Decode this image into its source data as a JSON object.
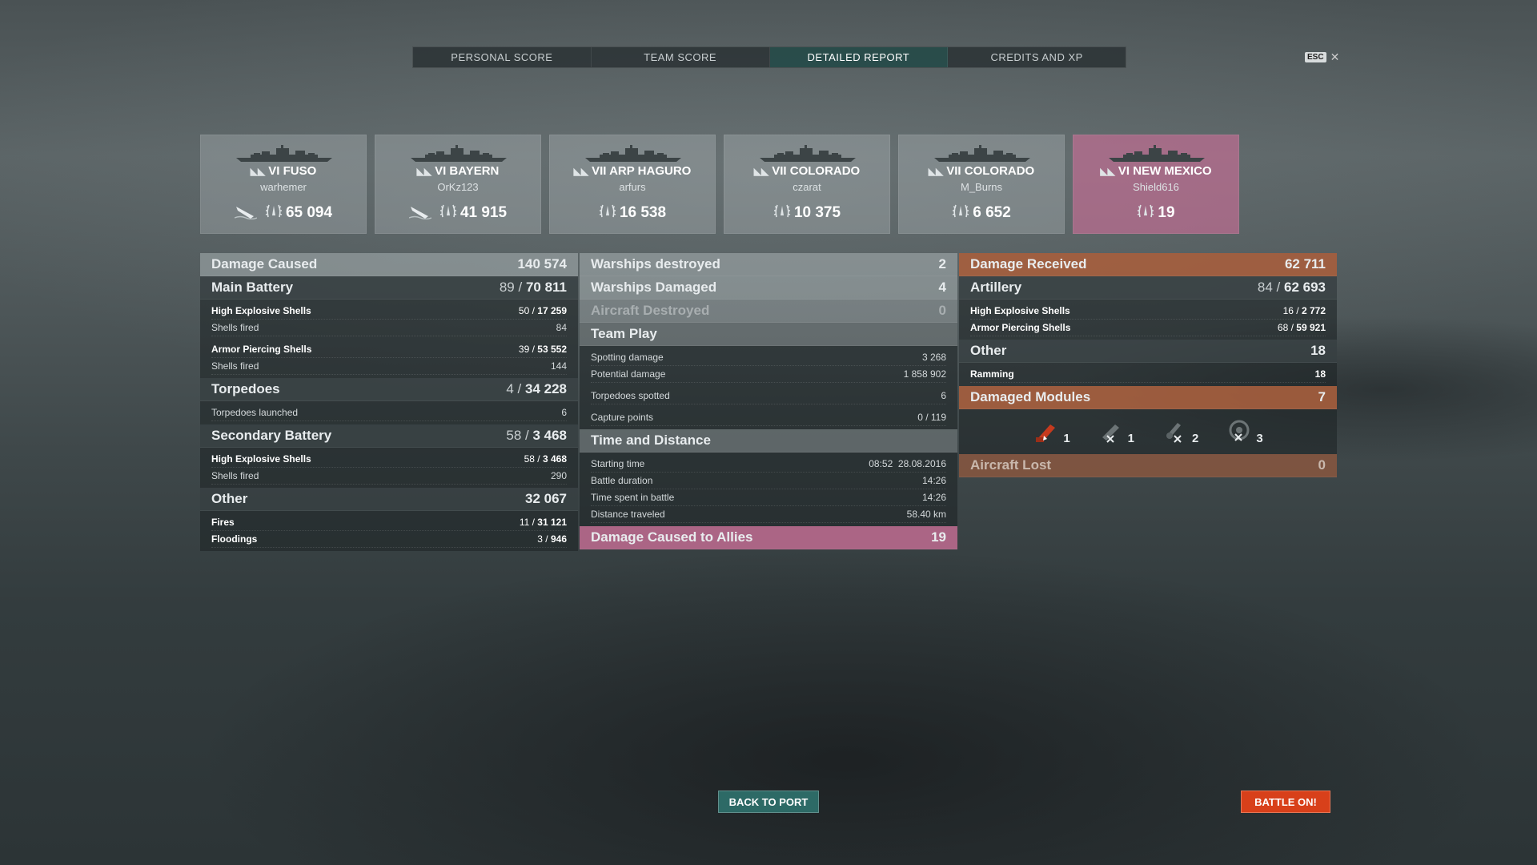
{
  "tabs": [
    "PERSONAL SCORE",
    "TEAM SCORE",
    "DETAILED REPORT",
    "CREDITS AND XP"
  ],
  "active_tab": "DETAILED REPORT",
  "esc_label": "ESC",
  "ships": [
    {
      "tier": "VI",
      "name": "FUSO",
      "player": "warhemer",
      "damage": "65 094",
      "sunk": true
    },
    {
      "tier": "VI",
      "name": "BAYERN",
      "player": "OrKz123",
      "damage": "41 915",
      "sunk": true
    },
    {
      "tier": "VII",
      "name": "ARP HAGURO",
      "player": "arfurs",
      "damage": "16 538",
      "sunk": false
    },
    {
      "tier": "VII",
      "name": "COLORADO",
      "player": "czarat",
      "damage": "10 375",
      "sunk": false
    },
    {
      "tier": "VII",
      "name": "COLORADO",
      "player": "M_Burns",
      "damage": "6 652",
      "sunk": false
    },
    {
      "tier": "VI",
      "name": "NEW MEXICO",
      "player": "Shield616",
      "damage": "19",
      "sunk": false
    }
  ],
  "left": {
    "damage_caused": {
      "label": "Damage Caused",
      "value": "140 574"
    },
    "main_battery": {
      "label": "Main Battery",
      "hits": "89",
      "dmg": "70 811"
    },
    "he": {
      "label": "High Explosive Shells",
      "hits": "50",
      "dmg": "17 259"
    },
    "he_fired": {
      "label": "Shells fired",
      "value": "84"
    },
    "ap": {
      "label": "Armor Piercing Shells",
      "hits": "39",
      "dmg": "53 552"
    },
    "ap_fired": {
      "label": "Shells fired",
      "value": "144"
    },
    "torpedoes": {
      "label": "Torpedoes",
      "hits": "4",
      "dmg": "34 228"
    },
    "torp_launched": {
      "label": "Torpedoes launched",
      "value": "6"
    },
    "secondary": {
      "label": "Secondary Battery",
      "hits": "58",
      "dmg": "3 468"
    },
    "sec_he": {
      "label": "High Explosive Shells",
      "hits": "58",
      "dmg": "3 468"
    },
    "sec_fired": {
      "label": "Shells fired",
      "value": "290"
    },
    "other": {
      "label": "Other",
      "value": "32 067"
    },
    "fires": {
      "label": "Fires",
      "hits": "11",
      "dmg": "31 121"
    },
    "floodings": {
      "label": "Floodings",
      "hits": "3",
      "dmg": "946"
    }
  },
  "mid": {
    "destroyed": {
      "label": "Warships destroyed",
      "value": "2"
    },
    "damaged": {
      "label": "Warships Damaged",
      "value": "4"
    },
    "aircraft": {
      "label": "Aircraft Destroyed",
      "value": "0"
    },
    "teamplay": {
      "label": "Team Play"
    },
    "spotting": {
      "label": "Spotting damage",
      "value": "3 268"
    },
    "potential": {
      "label": "Potential damage",
      "value": "1 858 902"
    },
    "torp_spotted": {
      "label": "Torpedoes spotted",
      "value": "6"
    },
    "capture": {
      "label": "Capture points",
      "value": "0 / 119"
    },
    "time": {
      "label": "Time and Distance"
    },
    "start": {
      "label": "Starting time",
      "value": "08:52  28.08.2016"
    },
    "duration": {
      "label": "Battle duration",
      "value": "14:26"
    },
    "spent": {
      "label": "Time spent in battle",
      "value": "14:26"
    },
    "distance": {
      "label": "Distance traveled",
      "value": "58.40 km"
    },
    "allies": {
      "label": "Damage Caused to Allies",
      "value": "19"
    }
  },
  "right": {
    "received": {
      "label": "Damage Received",
      "value": "62 711"
    },
    "artillery": {
      "label": "Artillery",
      "hits": "84",
      "dmg": "62 693"
    },
    "he": {
      "label": "High Explosive Shells",
      "hits": "16",
      "dmg": "2 772"
    },
    "ap": {
      "label": "Armor Piercing Shells",
      "hits": "68",
      "dmg": "59 921"
    },
    "other": {
      "label": "Other",
      "value": "18"
    },
    "ramming": {
      "label": "Ramming",
      "value": "18"
    },
    "modules": {
      "label": "Damaged Modules",
      "value": "7"
    },
    "module_counts": [
      "1",
      "1",
      "2",
      "3"
    ],
    "aircraft_lost": {
      "label": "Aircraft Lost",
      "value": "0"
    }
  },
  "buttons": {
    "port": "BACK TO PORT",
    "battle": "BATTLE ON!"
  }
}
